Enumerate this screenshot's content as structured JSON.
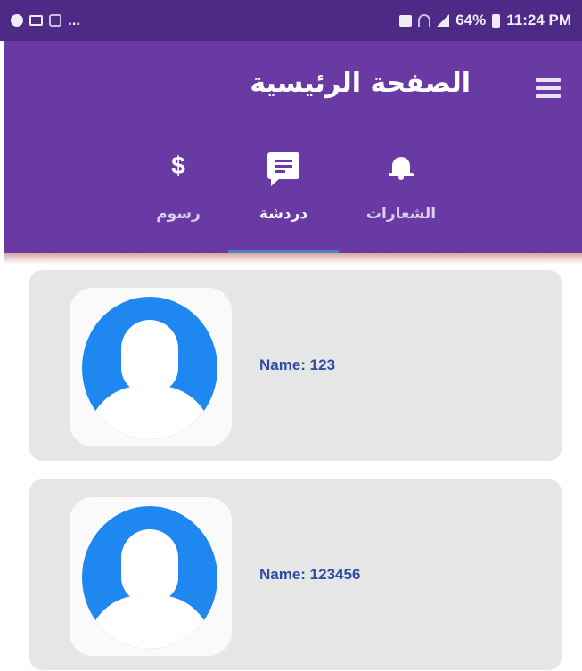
{
  "status_bar": {
    "left_dots": "...",
    "battery": "64%",
    "time": "11:24 PM"
  },
  "app_bar": {
    "title": "الصفحة الرئيسية",
    "menu_icon": "hamburger-icon"
  },
  "tabs": [
    {
      "label": "رسوم",
      "icon": "dollar-icon",
      "glyph": "$",
      "active": false
    },
    {
      "label": "دردشة",
      "icon": "chat-icon",
      "active": true
    },
    {
      "label": "الشعارات",
      "icon": "bell-icon",
      "active": false
    }
  ],
  "cards": [
    {
      "name": "Name: 123",
      "avatar": "default-user-avatar"
    },
    {
      "name": "Name: 123456",
      "avatar": "default-user-avatar"
    }
  ],
  "colors": {
    "status_bar": "#4e2a87",
    "app_bar": "#6a3aa4",
    "tab_indicator": "#4a84c8",
    "card_bg": "#e6e6e6",
    "avatar_blue": "#1e88f0",
    "name_text": "#2f4da0"
  }
}
